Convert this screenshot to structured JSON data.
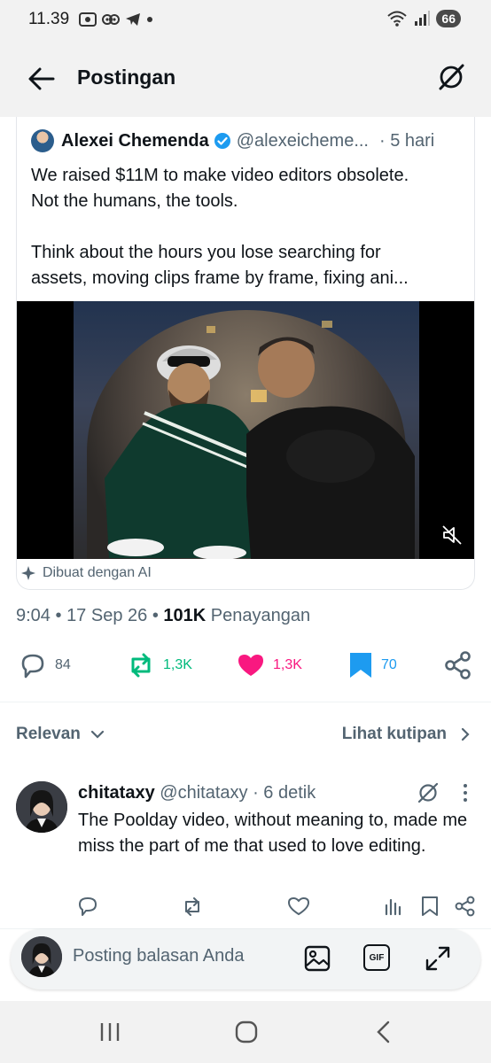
{
  "status_bar": {
    "time": "11.39",
    "battery": "66"
  },
  "header": {
    "title": "Postingan"
  },
  "quoted_post": {
    "author_name": "Alexei Chemenda",
    "author_handle": "@alexeicheme...",
    "time_ago": "· 5 hari",
    "text_line1": "We raised $11M to make video editors obsolete.",
    "text_line2": "Not the humans, the tools.",
    "text_line3": "Think about the hours you lose searching for",
    "text_line4": "assets, moving clips frame by frame, fixing ani...",
    "ai_label": "Dibuat dengan AI"
  },
  "post_meta": {
    "time": "9:04",
    "sep1": " • ",
    "date": "17 Sep 26",
    "sep2": " • ",
    "views": "101K",
    "views_label": " Penayangan"
  },
  "actions": {
    "replies": "84",
    "reposts": "1,3K",
    "likes": "1,3K",
    "bookmarks": "70"
  },
  "colors": {
    "repost_green": "#00ba7c",
    "like_pink": "#f91880",
    "bookmark_blue": "#1d9bf0",
    "muted_gray": "#536471"
  },
  "filter": {
    "sort_label": "Relevan",
    "quotes_label": "Lihat kutipan"
  },
  "reply": {
    "name": "chitataxy",
    "handle": "@chitataxy",
    "time_ago": "· 6 detik",
    "text": "The Poolday video, without meaning to, made me miss the part of me that used to love editing."
  },
  "compose": {
    "placeholder": "Posting balasan Anda",
    "gif_label": "GIF"
  }
}
